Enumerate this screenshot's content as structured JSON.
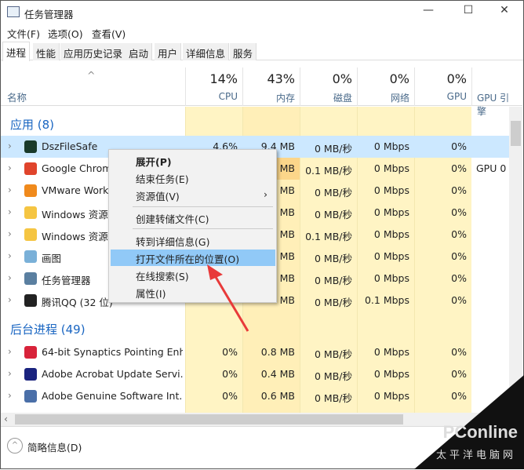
{
  "window": {
    "title": "任务管理器",
    "minimize": "—",
    "maximize": "☐",
    "close": "✕"
  },
  "menubar": [
    "文件(F)",
    "选项(O)",
    "查看(V)"
  ],
  "tabs": [
    "进程",
    "性能",
    "应用历史记录",
    "启动",
    "用户",
    "详细信息",
    "服务"
  ],
  "columns": {
    "name": "名称",
    "sort": "^",
    "cpu": {
      "pct": "14%",
      "label": "CPU"
    },
    "mem": {
      "pct": "43%",
      "label": "内存"
    },
    "disk": {
      "pct": "0%",
      "label": "磁盘"
    },
    "net": {
      "pct": "0%",
      "label": "网络"
    },
    "gpu": {
      "pct": "0%",
      "label": "GPU"
    },
    "gpu_engine": {
      "label": "GPU 引擎"
    }
  },
  "groups": {
    "apps": "应用 (8)",
    "background": "后台进程 (49)"
  },
  "apps": [
    {
      "name": "DszFileSafe",
      "cpu": "4.6%",
      "mem": "9.4 MB",
      "disk": "0 MB/秒",
      "net": "0 Mbps",
      "gpu": "0%",
      "engine": "",
      "icon": "#1a3a2a"
    },
    {
      "name": "Google Chrome",
      "cpu": "",
      "mem": "MB",
      "disk": "0.1 MB/秒",
      "net": "0 Mbps",
      "gpu": "0%",
      "engine": "GPU 0",
      "icon": "#e0442c"
    },
    {
      "name": "VMware Workstation",
      "cpu": "",
      "mem": "MB",
      "disk": "0 MB/秒",
      "net": "0 Mbps",
      "gpu": "0%",
      "engine": "",
      "icon": "#f08a1c"
    },
    {
      "name": "Windows 资源管理器",
      "cpu": "",
      "mem": "MB",
      "disk": "0 MB/秒",
      "net": "0 Mbps",
      "gpu": "0%",
      "engine": "",
      "icon": "#f5c542"
    },
    {
      "name": "Windows 资源管理器",
      "cpu": "",
      "mem": "MB",
      "disk": "0.1 MB/秒",
      "net": "0 Mbps",
      "gpu": "0%",
      "engine": "",
      "icon": "#f5c542"
    },
    {
      "name": "画图",
      "cpu": "",
      "mem": "MB",
      "disk": "0 MB/秒",
      "net": "0 Mbps",
      "gpu": "0%",
      "engine": "",
      "icon": "#7ab0d8"
    },
    {
      "name": "任务管理器",
      "cpu": "",
      "mem": "MB",
      "disk": "0 MB/秒",
      "net": "0 Mbps",
      "gpu": "0%",
      "engine": "",
      "icon": "#5a7fa0"
    },
    {
      "name": "腾讯QQ (32 位)",
      "cpu": "",
      "mem": "MB",
      "disk": "0 MB/秒",
      "net": "0.1 Mbps",
      "gpu": "0%",
      "engine": "",
      "icon": "#222"
    }
  ],
  "background": [
    {
      "name": "64-bit Synaptics Pointing Enh...",
      "cpu": "0%",
      "mem": "0.8 MB",
      "disk": "0 MB/秒",
      "net": "0 Mbps",
      "gpu": "0%",
      "engine": "",
      "icon": "#d8233a"
    },
    {
      "name": "Adobe Acrobat Update Servi...",
      "cpu": "0%",
      "mem": "0.4 MB",
      "disk": "0 MB/秒",
      "net": "0 Mbps",
      "gpu": "0%",
      "engine": "",
      "icon": "#1a237e"
    },
    {
      "name": "Adobe Genuine Software Int...",
      "cpu": "0%",
      "mem": "0.6 MB",
      "disk": "0 MB/秒",
      "net": "0 Mbps",
      "gpu": "0%",
      "engine": "",
      "icon": "#4a6fa8"
    }
  ],
  "context_menu": [
    "展开(P)",
    "结束任务(E)",
    "资源值(V)",
    "创建转储文件(C)",
    "转到详细信息(G)",
    "打开文件所在的位置(O)",
    "在线搜索(S)",
    "属性(I)"
  ],
  "context_submenu_arrow": "›",
  "footer": {
    "label": "简略信息(D)",
    "icon": "^"
  },
  "watermark": {
    "brand": "PConline",
    "sub": "太平洋电脑网"
  },
  "colors": {
    "accent": "#1a66c2",
    "selection": "#cce8ff",
    "highlight": "#91c9f7",
    "heat": "#fff4c4",
    "arrow": "#e83a3a"
  }
}
